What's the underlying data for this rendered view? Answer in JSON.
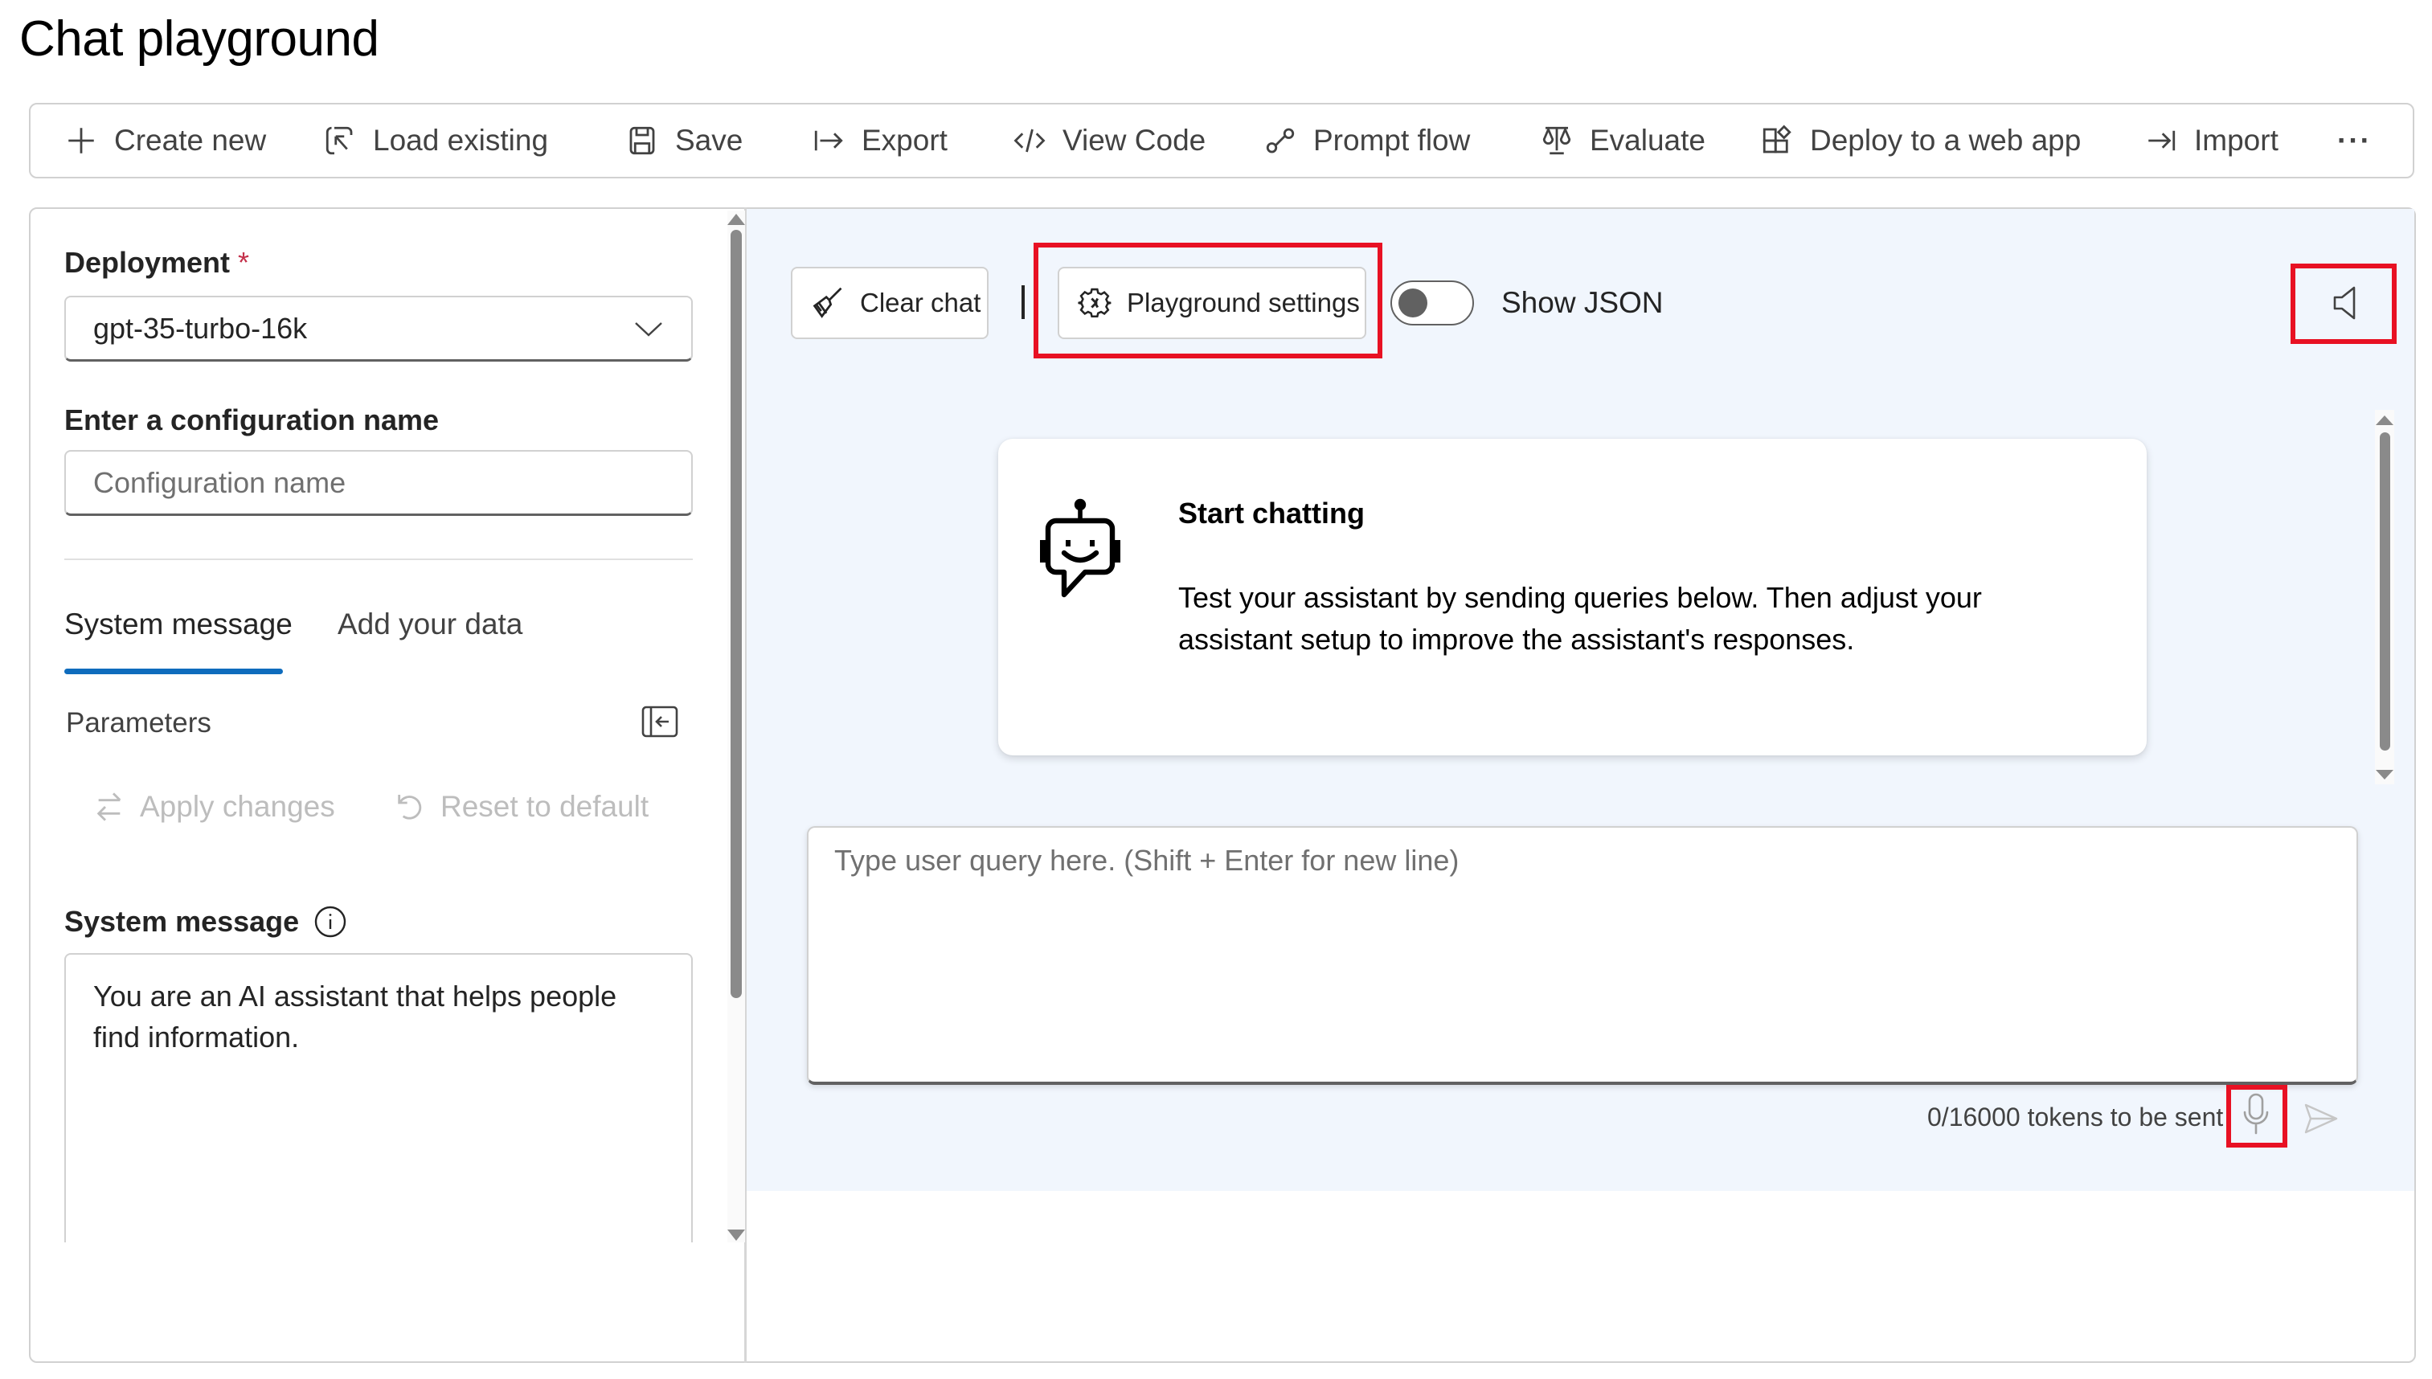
{
  "page": {
    "title": "Chat playground"
  },
  "toolbar": {
    "items": [
      {
        "label": "Create new",
        "icon": "plus-icon"
      },
      {
        "label": "Load existing",
        "icon": "load-icon"
      },
      {
        "label": "Save",
        "icon": "save-icon"
      },
      {
        "label": "Export",
        "icon": "export-icon"
      },
      {
        "label": "View Code",
        "icon": "code-icon"
      },
      {
        "label": "Prompt flow",
        "icon": "flow-icon"
      },
      {
        "label": "Evaluate",
        "icon": "scale-icon"
      },
      {
        "label": "Deploy to a web app",
        "icon": "apps-icon"
      },
      {
        "label": "Import",
        "icon": "import-icon"
      }
    ],
    "more_label": "···"
  },
  "left_panel": {
    "deployment": {
      "label": "Deployment",
      "required_mark": "*",
      "value": "gpt-35-turbo-16k"
    },
    "config_name": {
      "label": "Enter a configuration name",
      "placeholder": "Configuration name",
      "value": ""
    },
    "tabs": [
      {
        "label": "System message",
        "active": true
      },
      {
        "label": "Add your data",
        "active": false
      }
    ],
    "parameters_label": "Parameters",
    "apply_changes_label": "Apply changes",
    "reset_label": "Reset to default",
    "system_message": {
      "label": "System message",
      "value": "You are an AI assistant that helps people find information."
    }
  },
  "chat": {
    "clear_chat_label": "Clear chat",
    "playground_settings_label": "Playground settings",
    "show_json": {
      "label": "Show JSON",
      "on": false
    },
    "welcome_card": {
      "title": "Start chatting",
      "body": "Test your assistant by sending queries below. Then adjust your assistant setup to improve the assistant's responses."
    },
    "query_input": {
      "placeholder": "Type user query here. (Shift + Enter for new line)",
      "value": ""
    },
    "tokens_status": "0/16000 tokens to be sent"
  },
  "colors": {
    "accent": "#0f6cbd",
    "highlight": "#e81123",
    "chat_background": "#f1f6fd",
    "required": "#c4314b"
  }
}
